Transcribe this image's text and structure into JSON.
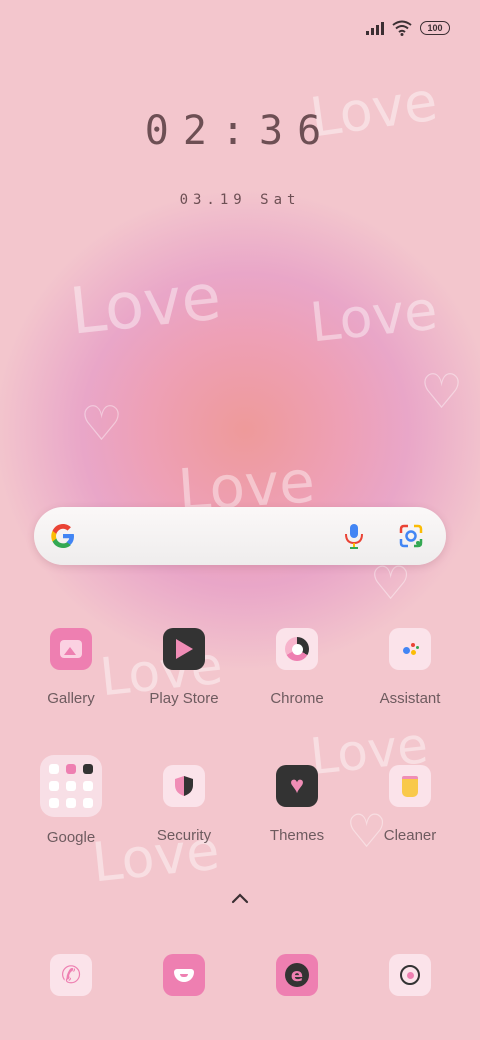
{
  "status_bar": {
    "battery": "100"
  },
  "lock": {
    "time": "02:36",
    "date": "03.19 Sat"
  },
  "wallpaper": {
    "word": "Love"
  },
  "apps_row1": [
    {
      "label": "Gallery",
      "icon": "gallery-icon"
    },
    {
      "label": "Play Store",
      "icon": "play-store-icon"
    },
    {
      "label": "Chrome",
      "icon": "chrome-icon"
    },
    {
      "label": "Assistant",
      "icon": "assistant-icon"
    }
  ],
  "apps_row2": [
    {
      "label": "Google",
      "icon": "google-folder-icon"
    },
    {
      "label": "Security",
      "icon": "security-icon"
    },
    {
      "label": "Themes",
      "icon": "themes-icon"
    },
    {
      "label": "Cleaner",
      "icon": "cleaner-icon"
    }
  ],
  "dock": [
    {
      "icon": "phone-icon"
    },
    {
      "icon": "messages-icon"
    },
    {
      "icon": "browser-icon"
    },
    {
      "icon": "camera-icon"
    }
  ],
  "colors": {
    "background": "#f3c6cd",
    "text": "#6d4f54",
    "accent_pink": "#ee7fb1"
  }
}
